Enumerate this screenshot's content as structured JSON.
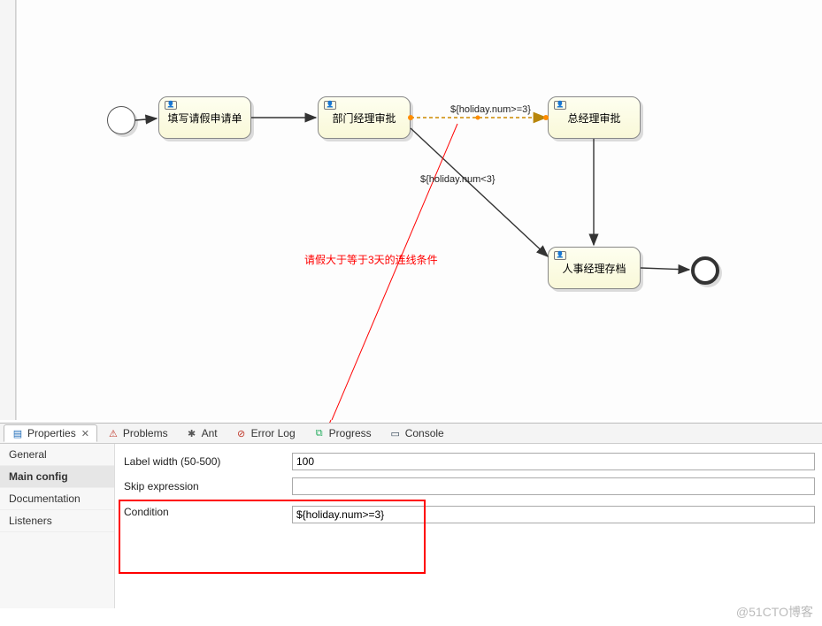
{
  "nodes": {
    "start": {
      "label": ""
    },
    "task1": {
      "label": "填写请假申请单"
    },
    "task2": {
      "label": "部门经理审批"
    },
    "task3": {
      "label": "总经理审批"
    },
    "task4": {
      "label": "人事经理存档"
    },
    "end": {
      "label": ""
    }
  },
  "edge_labels": {
    "cond_ge3": "${holiday.num>=3}",
    "cond_lt3": "${holiday.num<3}"
  },
  "annotation": "请假大于等于3天的连线条件",
  "tabs": {
    "properties": "Properties",
    "problems": "Problems",
    "ant": "Ant",
    "errorlog": "Error Log",
    "progress": "Progress",
    "console": "Console"
  },
  "properties_nav": {
    "general": "General",
    "main_config": "Main config",
    "documentation": "Documentation",
    "listeners": "Listeners"
  },
  "form": {
    "label_width_label": "Label width (50-500)",
    "label_width_value": "100",
    "skip_expression_label": "Skip expression",
    "skip_expression_value": "",
    "condition_label": "Condition",
    "condition_value": "${holiday.num>=3}"
  },
  "watermark": "@51CTO博客"
}
